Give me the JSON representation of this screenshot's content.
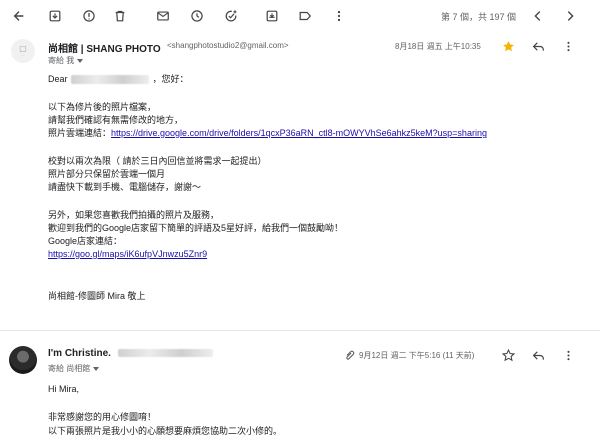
{
  "toolbar": {
    "pager_text": "第 7 個，共 197 個"
  },
  "message1": {
    "sender_name": "尚相館 | SHANG PHOTO",
    "sender_email": "<shangphotostudio2@gmail.com>",
    "to_label": "寄給 我",
    "date": "8月18日 週五 上午10:35",
    "greeting_prefix": "Dear",
    "greeting_suffix": "，您好：",
    "para1_line1": "以下為修片後的照片檔案，",
    "para1_line2": "請幫我們確認有無需修改的地方，",
    "para1_line3_label": "照片雲端連結：",
    "drive_link": "https://drive.google.com/drive/folders/1qcxP36aRN_ctl8-mOWYVhSe6ahkz5keM?usp=sharing",
    "para2_line1": "校對以兩次為限（ 請於三日內回信並將需求一起提出）",
    "para2_line2": "照片部分只保留於雲端一個月",
    "para2_line3": "請盡快下載到手機、電腦儲存，謝謝～",
    "para3_line1": "另外，如果您喜歡我們拍攝的照片及服務，",
    "para3_line2": "歡迎到我們的Google店家留下簡單的評語及5星好評，給我們一個鼓勵呦！",
    "para3_line3": "Google店家連結：",
    "maps_link": "https://goo.gl/maps/iK6ufpVJnwzu5Znr9",
    "signature": "尚相館-修圖師 Mira 敬上"
  },
  "message2": {
    "sender_name": "I'm Christine.",
    "to_label": "寄給 尚相館",
    "date": "9月12日 週二 下午5:16 (11 天前)",
    "greeting": "Hi Mira,",
    "line1": "非常感謝您的用心修圖唷！",
    "line2": "以下兩張照片是我小小的心願想要麻煩您協助二次小修的。"
  },
  "colors": {
    "star": "#f4b400",
    "link": "#1a0dab",
    "muted": "#5f6368"
  }
}
